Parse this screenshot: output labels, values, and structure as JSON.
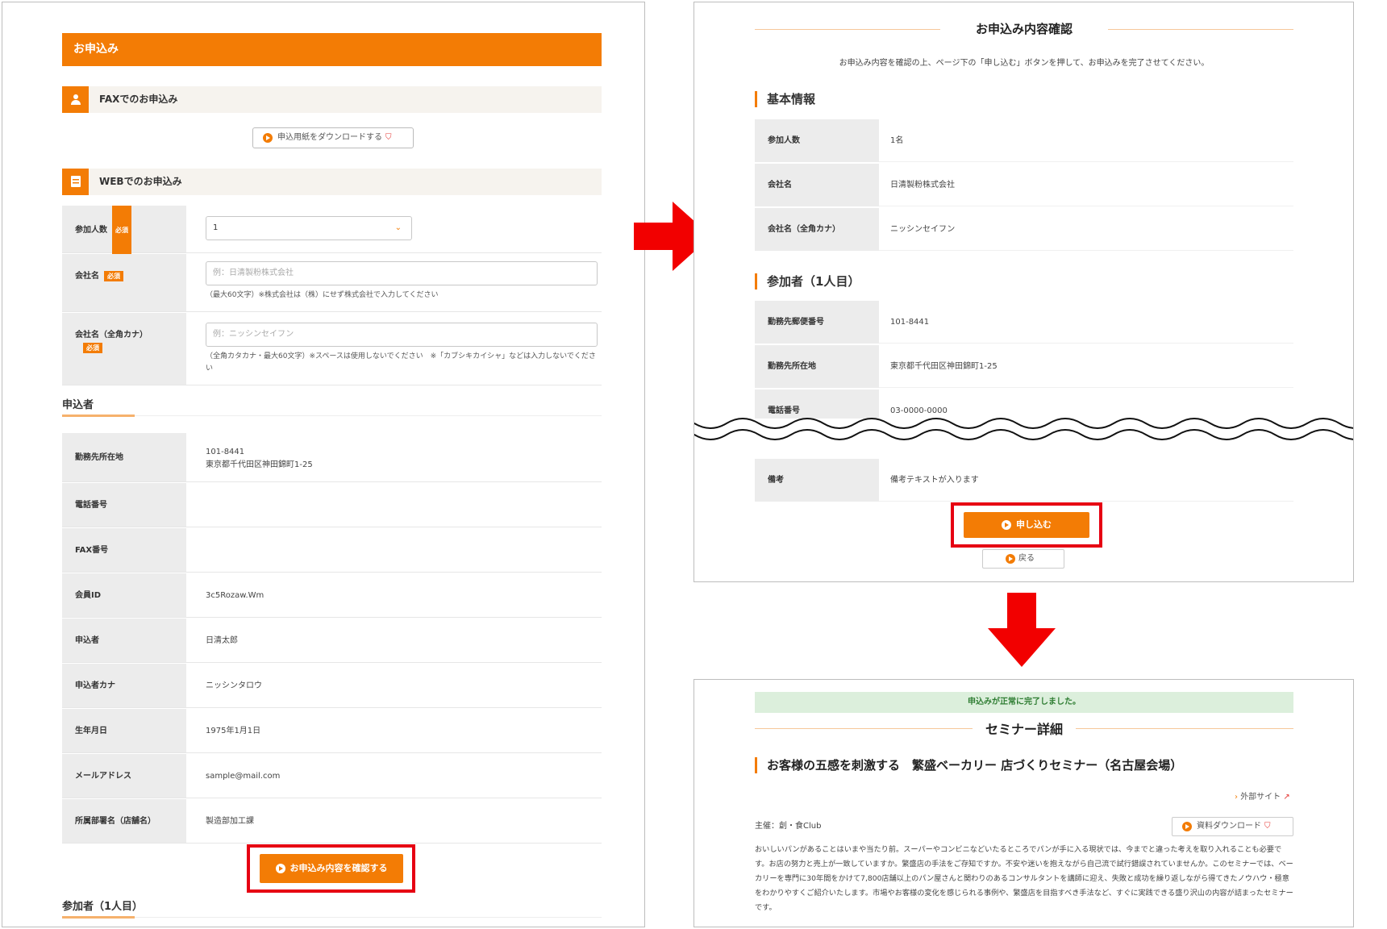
{
  "form": {
    "header": "お申込み",
    "fax_section": "FAXでのお申込み",
    "download_button": "申込用紙をダウンロードする",
    "web_section": "WEBでのお申込み",
    "required_badge": "必須",
    "participants": {
      "label": "参加人数",
      "value": "1"
    },
    "company": {
      "label": "会社名",
      "placeholder": "例：日清製粉株式会社",
      "hint": "（最大60文字）※株式会社は（株）にせず株式会社で入力してください"
    },
    "company_kana": {
      "label": "会社名（全角カナ）",
      "placeholder": "例：ニッシンセイフン",
      "hint": "（全角カタカナ・最大60文字）※スペースは使用しないでください　※「カブシキカイシャ」などは入力しないでください"
    },
    "applicant_heading": "申込者",
    "applicant_rows": [
      {
        "label": "勤務先所在地",
        "value": "101-8441",
        "value2": "東京都千代田区神田錦町1-25"
      },
      {
        "label": "電話番号",
        "value": ""
      },
      {
        "label": "FAX番号",
        "value": ""
      },
      {
        "label": "会員ID",
        "value": "3c5Rozaw.Wm"
      },
      {
        "label": "申込者",
        "value": "日清太郎"
      },
      {
        "label": "申込者カナ",
        "value": "ニッシンタロウ"
      },
      {
        "label": "生年月日",
        "value": "1975年1月1日"
      },
      {
        "label": "メールアドレス",
        "value": "sample@mail.com"
      },
      {
        "label": "所属部署名（店舗名）",
        "value": "製造部加工課"
      }
    ],
    "confirm_button": "お申込み内容を確認する",
    "participant_heading": "参加者（1人目）"
  },
  "confirm": {
    "title": "お申込み内容確認",
    "note": "お申込み内容を確認の上、ページ下の「申し込む」ボタンを押して、お申込みを完了させてください。",
    "basic_heading": "基本情報",
    "basic_rows": [
      {
        "label": "参加人数",
        "value": "1名"
      },
      {
        "label": "会社名",
        "value": "日清製粉株式会社"
      },
      {
        "label": "会社名（全角カナ）",
        "value": "ニッシンセイフン"
      }
    ],
    "participant_heading": "参加者（1人目）",
    "participant_rows": [
      {
        "label": "勤務先郵便番号",
        "value": "101-8441"
      },
      {
        "label": "勤務先所在地",
        "value": "東京都千代田区神田錦町1-25"
      },
      {
        "label": "電話番号",
        "value": "03-0000-0000"
      },
      {
        "label": "備考",
        "value": "備考テキストが入ります"
      }
    ],
    "submit_button": "申し込む",
    "back_button": "戻る"
  },
  "done": {
    "success": "申込みが正常に完了しました。",
    "title": "セミナー詳細",
    "seminar_title": "お客様の五感を刺激する　繁盛ベーカリー 店づくりセミナー（名古屋会場）",
    "external_link": "外部サイト",
    "host": "主催：創・食Club",
    "material_button": "資料ダウンロード",
    "description": "おいしいパンがあることはいまや当たり前。スーパーやコンビニなどいたるところでパンが手に入る現状では、今までと違った考えを取り入れることも必要です。お店の努力と売上が一致していますか。繁盛店の手法をご存知ですか。不安や迷いを抱えながら自己流で試行錯誤されていませんか。このセミナーでは、ベーカリーを専門に30年間をかけて7,800店舗以上のパン屋さんと関わりのあるコンサルタントを講師に迎え、失敗と成功を繰り返しながら得てきたノウハウ・極意をわかりやすくご紹介いたします。市場やお客様の変化を感じられる事例や、繁盛店を目指すべき手法など、すぐに実践できる盛り沢山の内容が詰まったセミナーです。"
  },
  "colors": {
    "accent": "#f37c05",
    "highlight": "#e60012",
    "success_bg": "#dcefdc"
  }
}
